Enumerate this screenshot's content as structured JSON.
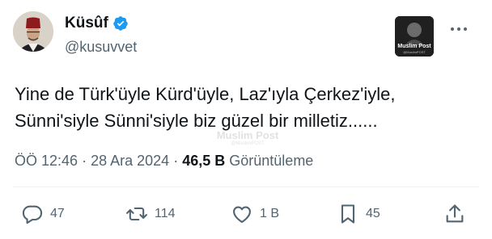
{
  "author": {
    "display_name": "Küsûf",
    "handle": "@kusuvvet",
    "verified": true
  },
  "media_thumb": {
    "label": "Muslim Post",
    "sub": "@MuslimPOST"
  },
  "tweet": {
    "text_line1": "Yine de Türk'üyle Kürd'üyle, Laz'ıyla Çerkez'iyle,",
    "text_line2": "Sünni'siyle Sünni'siyle biz güzel bir milletiz......"
  },
  "watermark": {
    "label": "Muslim Post",
    "sub": "@MuslimPOST"
  },
  "meta": {
    "time": "ÖÖ 12:46",
    "sep1": "·",
    "date": "28 Ara 2024",
    "sep2": "·",
    "views_count": "46,5 B",
    "views_label": "Görüntüleme"
  },
  "actions": {
    "replies": "47",
    "reposts": "114",
    "likes": "1 B",
    "bookmarks": "45"
  },
  "icons": [
    "verified-icon",
    "more-icon",
    "reply-icon",
    "repost-icon",
    "like-icon",
    "bookmark-icon",
    "share-icon"
  ],
  "colors": {
    "text": "#0f1419",
    "secondary": "#536471",
    "verified": "#1d9bf0",
    "divider": "#eff3f4"
  }
}
